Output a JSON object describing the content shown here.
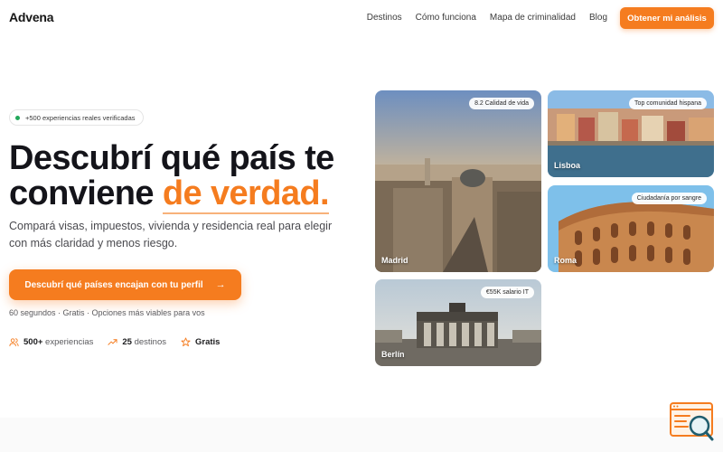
{
  "header": {
    "logo": "Advena",
    "nav": [
      "Destinos",
      "Cómo funciona",
      "Mapa de criminalidad",
      "Blog"
    ],
    "cta": "Obtener mi análisis"
  },
  "hero": {
    "badge": "+500 experiencias reales verificadas",
    "title_line1": "Descubrí qué país te",
    "title_line2_start": "conviene ",
    "title_line2_accent": "de verdad.",
    "subtitle": "Compará visas, impuestos, vivienda y residencia real para elegir con más claridad y menos riesgo.",
    "cta": "Descubrí qué países encajan con tu perfil",
    "cta_arrow": "→",
    "hint": "60 segundos · Gratis · Opciones más viables para vos",
    "stats": [
      {
        "icon": "users-icon",
        "value": "500+",
        "label": " experiencias"
      },
      {
        "icon": "trend-up-icon",
        "value": "25",
        "label": " destinos"
      },
      {
        "icon": "star-icon",
        "value": "Gratis",
        "label": ""
      }
    ]
  },
  "cards": {
    "madrid": {
      "name": "Madrid",
      "tag": "8.2 Calidad de vida"
    },
    "lisboa": {
      "name": "Lisboa",
      "tag": "Top comunidad hispana"
    },
    "roma": {
      "name": "Roma",
      "tag": "Ciudadanía por sangre"
    },
    "berlin": {
      "name": "Berlín",
      "tag": "€55K salario IT"
    }
  },
  "colors": {
    "accent": "#f57c1f",
    "badge_dot": "#22a75a"
  }
}
